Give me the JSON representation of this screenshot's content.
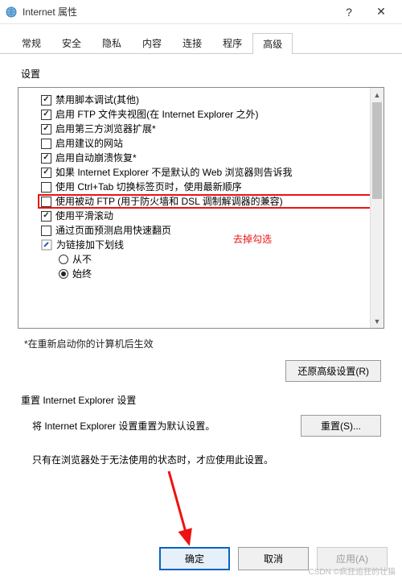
{
  "window": {
    "title": "Internet 属性"
  },
  "tabs": {
    "items": [
      {
        "label": "常规"
      },
      {
        "label": "安全"
      },
      {
        "label": "隐私"
      },
      {
        "label": "内容"
      },
      {
        "label": "连接"
      },
      {
        "label": "程序"
      },
      {
        "label": "高级"
      }
    ],
    "activeIndex": 6
  },
  "settings": {
    "label": "设置",
    "items": [
      {
        "type": "checkbox",
        "checked": true,
        "label": "禁用脚本调试(其他)"
      },
      {
        "type": "checkbox",
        "checked": true,
        "label": "启用 FTP 文件夹视图(在 Internet Explorer 之外)"
      },
      {
        "type": "checkbox",
        "checked": true,
        "label": "启用第三方浏览器扩展*"
      },
      {
        "type": "checkbox",
        "checked": false,
        "label": "启用建议的网站"
      },
      {
        "type": "checkbox",
        "checked": true,
        "label": "启用自动崩溃恢复*"
      },
      {
        "type": "checkbox",
        "checked": true,
        "label": "如果 Internet Explorer 不是默认的 Web 浏览器则告诉我"
      },
      {
        "type": "checkbox",
        "checked": false,
        "label": "使用 Ctrl+Tab 切换标签页时，使用最新顺序"
      },
      {
        "type": "checkbox",
        "checked": false,
        "label": "使用被动 FTP (用于防火墙和 DSL 调制解调器的兼容)",
        "highlight": true
      },
      {
        "type": "checkbox",
        "checked": true,
        "label": "使用平滑滚动"
      },
      {
        "type": "checkbox",
        "checked": false,
        "label": "通过页面预测启用快速翻页"
      },
      {
        "type": "group-icon",
        "label": "为链接加下划线"
      },
      {
        "type": "radio",
        "checked": false,
        "label": "从不",
        "sub": true
      },
      {
        "type": "radio",
        "checked": true,
        "label": "始终",
        "sub": true
      }
    ],
    "footnote": "*在重新启动你的计算机后生效",
    "restoreBtn": "还原高级设置(R)"
  },
  "reset": {
    "sectionLabel": "重置 Internet Explorer 设置",
    "desc": "将 Internet Explorer 设置重置为默认设置。",
    "btn": "重置(S)...",
    "note": "只有在浏览器处于无法使用的状态时，才应使用此设置。"
  },
  "footer": {
    "ok": "确定",
    "cancel": "取消",
    "apply": "应用(A)"
  },
  "annotation": "去掉勾选",
  "watermark": "CSDN ©疯狂追狂的壮猫"
}
